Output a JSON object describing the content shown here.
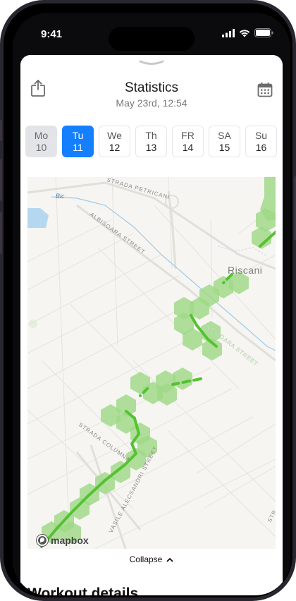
{
  "status_bar": {
    "time": "9:41"
  },
  "header": {
    "title": "Statistics",
    "subtitle": "May 23rd, 12:54",
    "share_icon": "share-icon",
    "calendar_icon": "calendar-icon"
  },
  "days": [
    {
      "name": "Mo",
      "date": "10",
      "state": "past"
    },
    {
      "name": "Tu",
      "date": "11",
      "state": "active"
    },
    {
      "name": "We",
      "date": "12",
      "state": "default"
    },
    {
      "name": "Th",
      "date": "13",
      "state": "default"
    },
    {
      "name": "FR",
      "date": "14",
      "state": "default"
    },
    {
      "name": "SA",
      "date": "15",
      "state": "default"
    },
    {
      "name": "Su",
      "date": "16",
      "state": "default"
    }
  ],
  "map": {
    "labels": {
      "petricani": "STRADA PETRICANI",
      "bic": "Bic",
      "albisoara_top": "ALBISOARA STREET",
      "riscani": "Riscani",
      "albisoara_route": "ALBISOARA STREET",
      "columna": "STRADA COLUMNA",
      "alecsandri": "VASILE ALECSANDRI STREET",
      "edge": "STR"
    },
    "attribution": "mapbox"
  },
  "collapse": {
    "label": "Collapse"
  },
  "section": {
    "title": "Workout details"
  },
  "colors": {
    "accent": "#1480ff",
    "route_fill": "#9ed884",
    "route_line": "#55c133"
  }
}
